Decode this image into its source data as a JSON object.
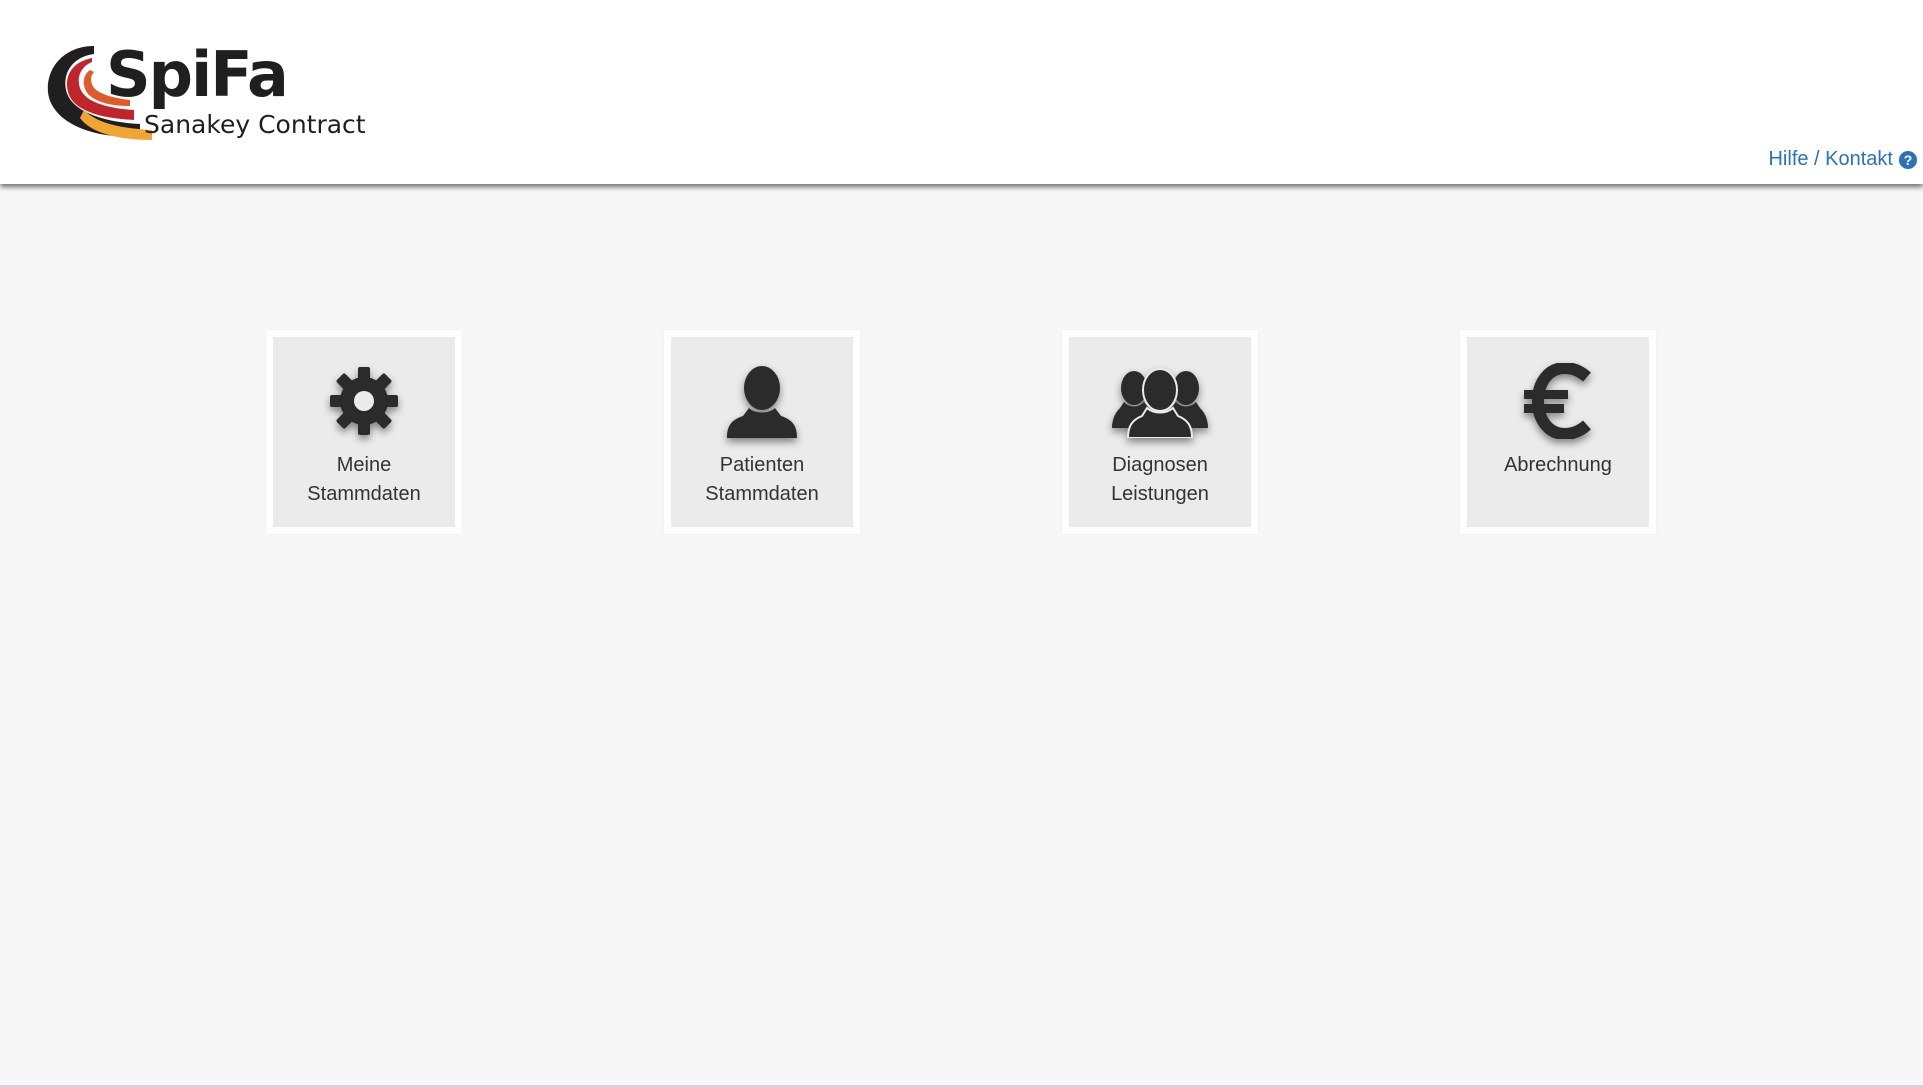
{
  "header": {
    "logo_text": "SpiFa",
    "logo_subtitle": "Sanakey Contract",
    "help_link_label": "Hilfe / Kontakt",
    "help_icon_glyph": "?"
  },
  "tiles": [
    {
      "line1": "Meine",
      "line2": "Stammdaten",
      "icon": "gear-icon"
    },
    {
      "line1": "Patienten",
      "line2": "Stammdaten",
      "icon": "user-icon"
    },
    {
      "line1": "Diagnosen",
      "line2": "Leistungen",
      "icon": "users-group-icon"
    },
    {
      "line1": "Abrechnung",
      "line2": "",
      "icon": "euro-icon"
    }
  ],
  "colors": {
    "link_blue": "#2a73b8",
    "icon_dark": "#2b2b2b",
    "tile_bg": "#ebebeb",
    "page_bg": "#f7f7f7",
    "logo_red": "#c0252b",
    "logo_orange": "#f2a531",
    "logo_black": "#1f1f1f"
  }
}
